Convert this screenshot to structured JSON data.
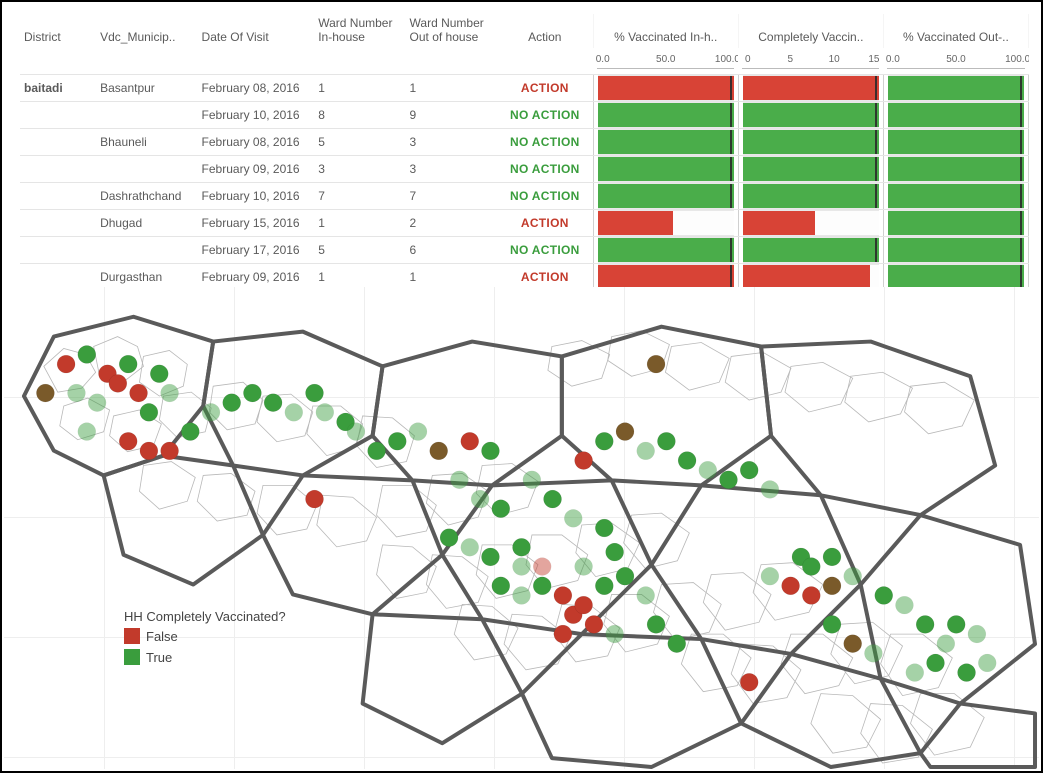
{
  "headers": {
    "district": "District",
    "vdc": "Vdc_Municip..",
    "date": "Date Of Visit",
    "ward_in": "Ward Number In-house",
    "ward_out": "Ward Number Out of house",
    "action": "Action",
    "bar1": "% Vaccinated In-h..",
    "bar2": "Completely Vaccin..",
    "bar3": "% Vaccinated Out-.."
  },
  "district": "baitadi",
  "axes": {
    "pct": {
      "min": 0.0,
      "max": 100.0,
      "ticks": [
        "0.0",
        "50.0",
        "100.0"
      ]
    },
    "count": {
      "min": 0,
      "max": 15,
      "ticks": [
        "0",
        "5",
        "10",
        "15"
      ]
    }
  },
  "chart_data": {
    "type": "table",
    "title": "",
    "columns": [
      "District",
      "Vdc_Municipality",
      "Date Of Visit",
      "Ward Number In-house",
      "Ward Number Out of house",
      "Action",
      "% Vaccinated In-house",
      "Completely Vaccinated",
      "% Vaccinated Out-house"
    ],
    "series_meta": [
      {
        "name": "% Vaccinated In-house",
        "range": [
          0.0,
          100.0
        ],
        "unit": "%"
      },
      {
        "name": "Completely Vaccinated",
        "range": [
          0,
          15
        ],
        "unit": "count"
      },
      {
        "name": "% Vaccinated Out-house",
        "range": [
          0.0,
          100.0
        ],
        "unit": "%"
      }
    ],
    "rows": [
      {
        "district": "baitadi",
        "vdc": "Basantpur",
        "date": "February 08, 2016",
        "ward_in": "1",
        "ward_out": "1",
        "action": "ACTION",
        "action_required": true,
        "pct_in": 100.0,
        "complete": 15,
        "pct_out": 100.0
      },
      {
        "district": "baitadi",
        "vdc": "Basantpur",
        "date": "February 10, 2016",
        "ward_in": "8",
        "ward_out": "9",
        "action": "NO ACTION",
        "action_required": false,
        "pct_in": 100.0,
        "complete": 15,
        "pct_out": 100.0
      },
      {
        "district": "baitadi",
        "vdc": "Bhauneli",
        "date": "February 08, 2016",
        "ward_in": "5",
        "ward_out": "3",
        "action": "NO ACTION",
        "action_required": false,
        "pct_in": 100.0,
        "complete": 15,
        "pct_out": 100.0
      },
      {
        "district": "baitadi",
        "vdc": "Bhauneli",
        "date": "February 09, 2016",
        "ward_in": "3",
        "ward_out": "3",
        "action": "NO ACTION",
        "action_required": false,
        "pct_in": 100.0,
        "complete": 15,
        "pct_out": 100.0
      },
      {
        "district": "baitadi",
        "vdc": "Dashrathchand",
        "date": "February 10, 2016",
        "ward_in": "7",
        "ward_out": "7",
        "action": "NO ACTION",
        "action_required": false,
        "pct_in": 100.0,
        "complete": 15,
        "pct_out": 100.0
      },
      {
        "district": "baitadi",
        "vdc": "Dhugad",
        "date": "February 15, 2016",
        "ward_in": "1",
        "ward_out": "2",
        "action": "ACTION",
        "action_required": true,
        "pct_in": 55.0,
        "complete": 8,
        "pct_out": 100.0
      },
      {
        "district": "baitadi",
        "vdc": "Dhugad",
        "date": "February 17, 2016",
        "ward_in": "5",
        "ward_out": "6",
        "action": "NO ACTION",
        "action_required": false,
        "pct_in": 100.0,
        "complete": 15,
        "pct_out": 100.0
      },
      {
        "district": "baitadi",
        "vdc": "Durgasthan",
        "date": "February 09, 2016",
        "ward_in": "1",
        "ward_out": "1",
        "action": "ACTION",
        "action_required": true,
        "pct_in": 100.0,
        "complete": 14,
        "pct_out": 100.0
      }
    ]
  },
  "legend": {
    "title": "HH Completely Vaccinated?",
    "false_label": "False",
    "true_label": "True"
  },
  "map": {
    "points": [
      {
        "x": 6,
        "y": 16,
        "v": false,
        "faded": false
      },
      {
        "x": 8,
        "y": 14,
        "v": true,
        "faded": false
      },
      {
        "x": 10,
        "y": 18,
        "v": false,
        "faded": false
      },
      {
        "x": 12,
        "y": 16,
        "v": true,
        "faded": false
      },
      {
        "x": 11,
        "y": 20,
        "v": false,
        "faded": false
      },
      {
        "x": 4,
        "y": 22,
        "v": "mix",
        "faded": false
      },
      {
        "x": 7,
        "y": 22,
        "v": true,
        "faded": true
      },
      {
        "x": 9,
        "y": 24,
        "v": true,
        "faded": true
      },
      {
        "x": 13,
        "y": 22,
        "v": false,
        "faded": false
      },
      {
        "x": 15,
        "y": 18,
        "v": true,
        "faded": false
      },
      {
        "x": 16,
        "y": 22,
        "v": true,
        "faded": true
      },
      {
        "x": 14,
        "y": 26,
        "v": true,
        "faded": false
      },
      {
        "x": 8,
        "y": 30,
        "v": true,
        "faded": true
      },
      {
        "x": 12,
        "y": 32,
        "v": false,
        "faded": false
      },
      {
        "x": 14,
        "y": 34,
        "v": false,
        "faded": false
      },
      {
        "x": 16,
        "y": 34,
        "v": false,
        "faded": false
      },
      {
        "x": 18,
        "y": 30,
        "v": true,
        "faded": false
      },
      {
        "x": 20,
        "y": 26,
        "v": true,
        "faded": true
      },
      {
        "x": 22,
        "y": 24,
        "v": true,
        "faded": false
      },
      {
        "x": 24,
        "y": 22,
        "v": true,
        "faded": false
      },
      {
        "x": 26,
        "y": 24,
        "v": true,
        "faded": false
      },
      {
        "x": 28,
        "y": 26,
        "v": true,
        "faded": true
      },
      {
        "x": 30,
        "y": 22,
        "v": true,
        "faded": false
      },
      {
        "x": 31,
        "y": 26,
        "v": true,
        "faded": true
      },
      {
        "x": 33,
        "y": 28,
        "v": true,
        "faded": false
      },
      {
        "x": 34,
        "y": 30,
        "v": true,
        "faded": true
      },
      {
        "x": 30,
        "y": 44,
        "v": false,
        "faded": false
      },
      {
        "x": 36,
        "y": 34,
        "v": true,
        "faded": false
      },
      {
        "x": 38,
        "y": 32,
        "v": true,
        "faded": false
      },
      {
        "x": 40,
        "y": 30,
        "v": true,
        "faded": true
      },
      {
        "x": 42,
        "y": 34,
        "v": "mix",
        "faded": false
      },
      {
        "x": 45,
        "y": 32,
        "v": false,
        "faded": false
      },
      {
        "x": 47,
        "y": 34,
        "v": true,
        "faded": false
      },
      {
        "x": 44,
        "y": 40,
        "v": true,
        "faded": true
      },
      {
        "x": 46,
        "y": 44,
        "v": true,
        "faded": true
      },
      {
        "x": 48,
        "y": 46,
        "v": true,
        "faded": false
      },
      {
        "x": 43,
        "y": 52,
        "v": true,
        "faded": false
      },
      {
        "x": 45,
        "y": 54,
        "v": true,
        "faded": true
      },
      {
        "x": 47,
        "y": 56,
        "v": true,
        "faded": false
      },
      {
        "x": 50,
        "y": 54,
        "v": true,
        "faded": false
      },
      {
        "x": 50,
        "y": 58,
        "v": true,
        "faded": true
      },
      {
        "x": 52,
        "y": 58,
        "v": false,
        "faded": true
      },
      {
        "x": 48,
        "y": 62,
        "v": true,
        "faded": false
      },
      {
        "x": 50,
        "y": 64,
        "v": true,
        "faded": true
      },
      {
        "x": 52,
        "y": 62,
        "v": true,
        "faded": false
      },
      {
        "x": 54,
        "y": 64,
        "v": false,
        "faded": false
      },
      {
        "x": 55,
        "y": 68,
        "v": false,
        "faded": false
      },
      {
        "x": 56,
        "y": 66,
        "v": false,
        "faded": false
      },
      {
        "x": 57,
        "y": 70,
        "v": false,
        "faded": false
      },
      {
        "x": 54,
        "y": 72,
        "v": false,
        "faded": false
      },
      {
        "x": 58,
        "y": 62,
        "v": true,
        "faded": false
      },
      {
        "x": 56,
        "y": 58,
        "v": true,
        "faded": true
      },
      {
        "x": 59,
        "y": 55,
        "v": true,
        "faded": false
      },
      {
        "x": 58,
        "y": 50,
        "v": true,
        "faded": false
      },
      {
        "x": 55,
        "y": 48,
        "v": true,
        "faded": true
      },
      {
        "x": 53,
        "y": 44,
        "v": true,
        "faded": false
      },
      {
        "x": 51,
        "y": 40,
        "v": true,
        "faded": true
      },
      {
        "x": 56,
        "y": 36,
        "v": false,
        "faded": false
      },
      {
        "x": 58,
        "y": 32,
        "v": true,
        "faded": false
      },
      {
        "x": 60,
        "y": 30,
        "v": "mix",
        "faded": false
      },
      {
        "x": 62,
        "y": 34,
        "v": true,
        "faded": true
      },
      {
        "x": 64,
        "y": 32,
        "v": true,
        "faded": false
      },
      {
        "x": 63,
        "y": 16,
        "v": "mix",
        "faded": false
      },
      {
        "x": 66,
        "y": 36,
        "v": true,
        "faded": false
      },
      {
        "x": 68,
        "y": 38,
        "v": true,
        "faded": true
      },
      {
        "x": 70,
        "y": 40,
        "v": true,
        "faded": false
      },
      {
        "x": 72,
        "y": 38,
        "v": true,
        "faded": false
      },
      {
        "x": 74,
        "y": 42,
        "v": true,
        "faded": true
      },
      {
        "x": 77,
        "y": 56,
        "v": true,
        "faded": false
      },
      {
        "x": 74,
        "y": 60,
        "v": true,
        "faded": true
      },
      {
        "x": 76,
        "y": 62,
        "v": false,
        "faded": false
      },
      {
        "x": 78,
        "y": 58,
        "v": true,
        "faded": false
      },
      {
        "x": 80,
        "y": 56,
        "v": true,
        "faded": false
      },
      {
        "x": 78,
        "y": 64,
        "v": false,
        "faded": false
      },
      {
        "x": 80,
        "y": 62,
        "v": "mix",
        "faded": false
      },
      {
        "x": 82,
        "y": 60,
        "v": true,
        "faded": true
      },
      {
        "x": 72,
        "y": 82,
        "v": false,
        "faded": false
      },
      {
        "x": 85,
        "y": 64,
        "v": true,
        "faded": false
      },
      {
        "x": 87,
        "y": 66,
        "v": true,
        "faded": true
      },
      {
        "x": 89,
        "y": 70,
        "v": true,
        "faded": false
      },
      {
        "x": 91,
        "y": 74,
        "v": true,
        "faded": true
      },
      {
        "x": 92,
        "y": 70,
        "v": true,
        "faded": false
      },
      {
        "x": 94,
        "y": 72,
        "v": true,
        "faded": true
      },
      {
        "x": 90,
        "y": 78,
        "v": true,
        "faded": false
      },
      {
        "x": 88,
        "y": 80,
        "v": true,
        "faded": true
      },
      {
        "x": 93,
        "y": 80,
        "v": true,
        "faded": false
      },
      {
        "x": 95,
        "y": 78,
        "v": true,
        "faded": true
      },
      {
        "x": 80,
        "y": 70,
        "v": true,
        "faded": false
      },
      {
        "x": 82,
        "y": 74,
        "v": "mix",
        "faded": false
      },
      {
        "x": 84,
        "y": 76,
        "v": true,
        "faded": true
      },
      {
        "x": 60,
        "y": 60,
        "v": true,
        "faded": false
      },
      {
        "x": 62,
        "y": 64,
        "v": true,
        "faded": true
      },
      {
        "x": 63,
        "y": 70,
        "v": true,
        "faded": false
      },
      {
        "x": 59,
        "y": 72,
        "v": true,
        "faded": true
      },
      {
        "x": 65,
        "y": 74,
        "v": true,
        "faded": false
      }
    ]
  }
}
